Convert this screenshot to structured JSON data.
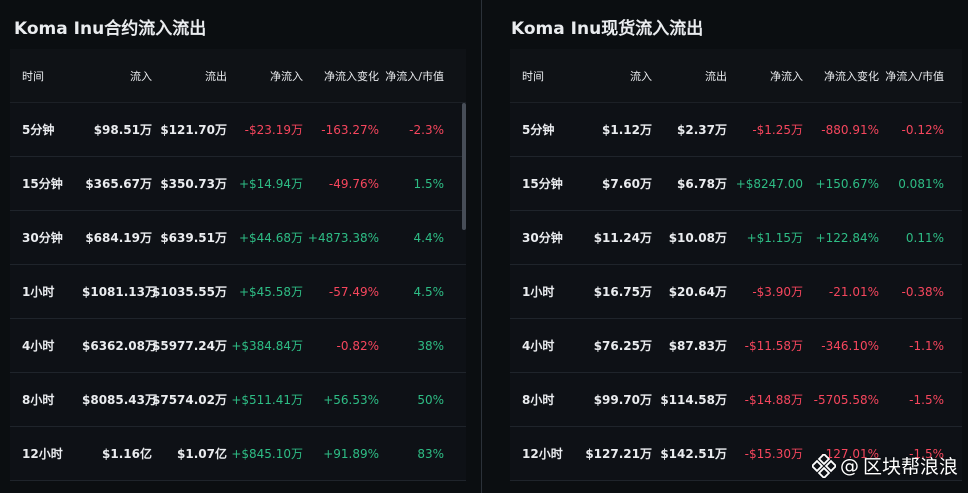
{
  "futures": {
    "title": "Koma Inu合约流入流出",
    "headers": [
      "时间",
      "流入",
      "流出",
      "净流入",
      "净流入变化",
      "净流入/市值"
    ],
    "rows": [
      [
        "5分钟",
        "$98.51万",
        "$121.70万",
        "-$23.19万",
        "-163.27%",
        "-2.3%"
      ],
      [
        "15分钟",
        "$365.67万",
        "$350.73万",
        "+$14.94万",
        "-49.76%",
        "1.5%"
      ],
      [
        "30分钟",
        "$684.19万",
        "$639.51万",
        "+$44.68万",
        "+4873.38%",
        "4.4%"
      ],
      [
        "1小时",
        "$1081.13万",
        "$1035.55万",
        "+$45.58万",
        "-57.49%",
        "4.5%"
      ],
      [
        "4小时",
        "$6362.08万",
        "$5977.24万",
        "+$384.84万",
        "-0.82%",
        "38%"
      ],
      [
        "8小时",
        "$8085.43万",
        "$7574.02万",
        "+$511.41万",
        "+56.53%",
        "50%"
      ],
      [
        "12小时",
        "$1.16亿",
        "$1.07亿",
        "+$845.10万",
        "+91.89%",
        "83%"
      ]
    ]
  },
  "spot": {
    "title": "Koma Inu现货流入流出",
    "headers": [
      "时间",
      "流入",
      "流出",
      "净流入",
      "净流入变化",
      "净流入/市值"
    ],
    "rows": [
      [
        "5分钟",
        "$1.12万",
        "$2.37万",
        "-$1.25万",
        "-880.91%",
        "-0.12%"
      ],
      [
        "15分钟",
        "$7.60万",
        "$6.78万",
        "+$8247.00",
        "+150.67%",
        "0.081%"
      ],
      [
        "30分钟",
        "$11.24万",
        "$10.08万",
        "+$1.15万",
        "+122.84%",
        "0.11%"
      ],
      [
        "1小时",
        "$16.75万",
        "$20.64万",
        "-$3.90万",
        "-21.01%",
        "-0.38%"
      ],
      [
        "4小时",
        "$76.25万",
        "$87.83万",
        "-$11.58万",
        "-346.10%",
        "-1.1%"
      ],
      [
        "8小时",
        "$99.70万",
        "$114.58万",
        "-$14.88万",
        "-5705.58%",
        "-1.5%"
      ],
      [
        "12小时",
        "$127.21万",
        "$142.51万",
        "-$15.30万",
        "-127.01%",
        "-1.5%"
      ]
    ]
  },
  "colors": {
    "positive": "#2ebd85",
    "negative": "#f6465d",
    "background": "#0b0e11"
  },
  "watermark": {
    "at": "@",
    "text": "区块帮浪浪",
    "logo_icon": "binance-square-logo-icon"
  }
}
